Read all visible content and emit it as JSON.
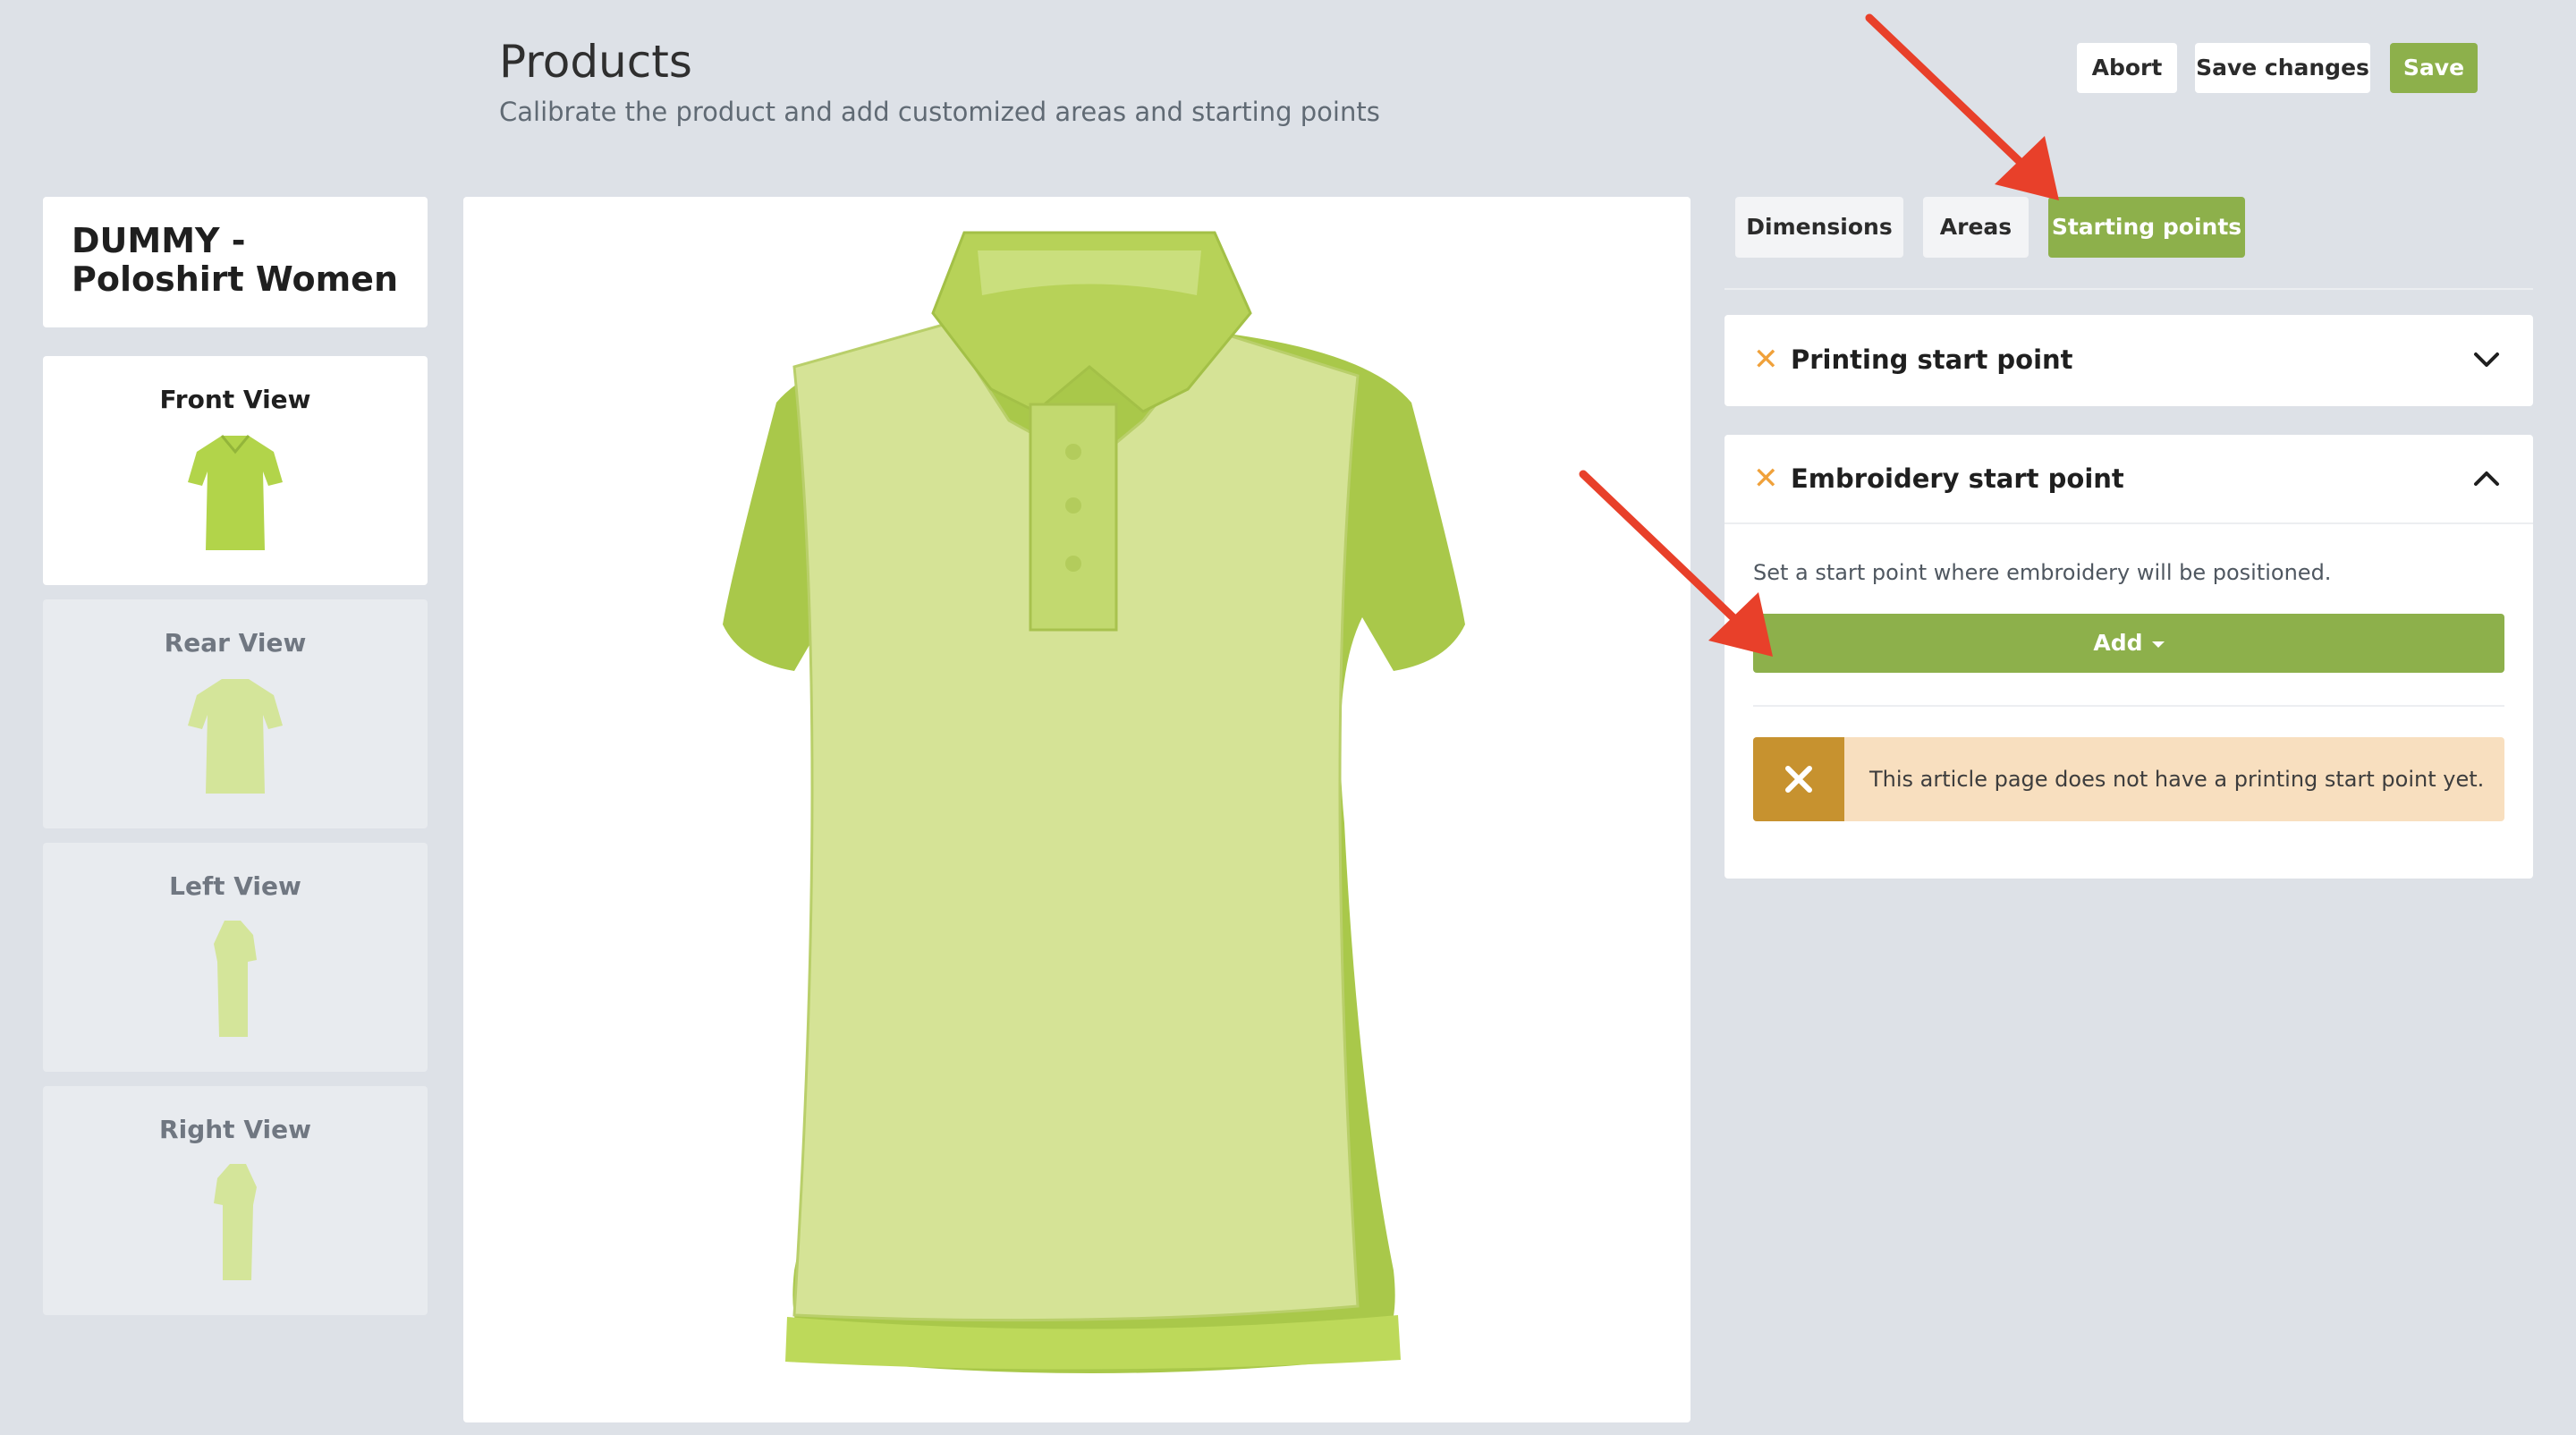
{
  "header": {
    "title": "Products",
    "subtitle": "Calibrate the product and add customized areas and starting points",
    "abort_label": "Abort",
    "save_changes_label": "Save changes",
    "save_label": "Save"
  },
  "product": {
    "name": "DUMMY - Poloshirt Women",
    "views": [
      {
        "label": "Front View",
        "active": true
      },
      {
        "label": "Rear View",
        "active": false
      },
      {
        "label": "Left View",
        "active": false
      },
      {
        "label": "Right View",
        "active": false
      }
    ],
    "shirt_color": "#b9d65a"
  },
  "tabs": [
    {
      "label": "Dimensions",
      "active": false
    },
    {
      "label": "Areas",
      "active": false
    },
    {
      "label": "Starting points",
      "active": true
    }
  ],
  "accordion": {
    "printing": {
      "title": "Printing start point",
      "status_icon": "close-icon",
      "expanded": false
    },
    "embroidery": {
      "title": "Embroidery start point",
      "status_icon": "close-icon",
      "expanded": true,
      "hint": "Set a start point where embroidery will be positioned.",
      "add_label": "Add",
      "alert_text": "This article page does not have a printing start point yet."
    }
  },
  "colors": {
    "accent": "#8db04b",
    "warning_bg": "#f8dfbf",
    "warning_icon_bg": "#c7922f",
    "status_x": "#f0a13a",
    "annotation_arrow": "#e8402a"
  }
}
